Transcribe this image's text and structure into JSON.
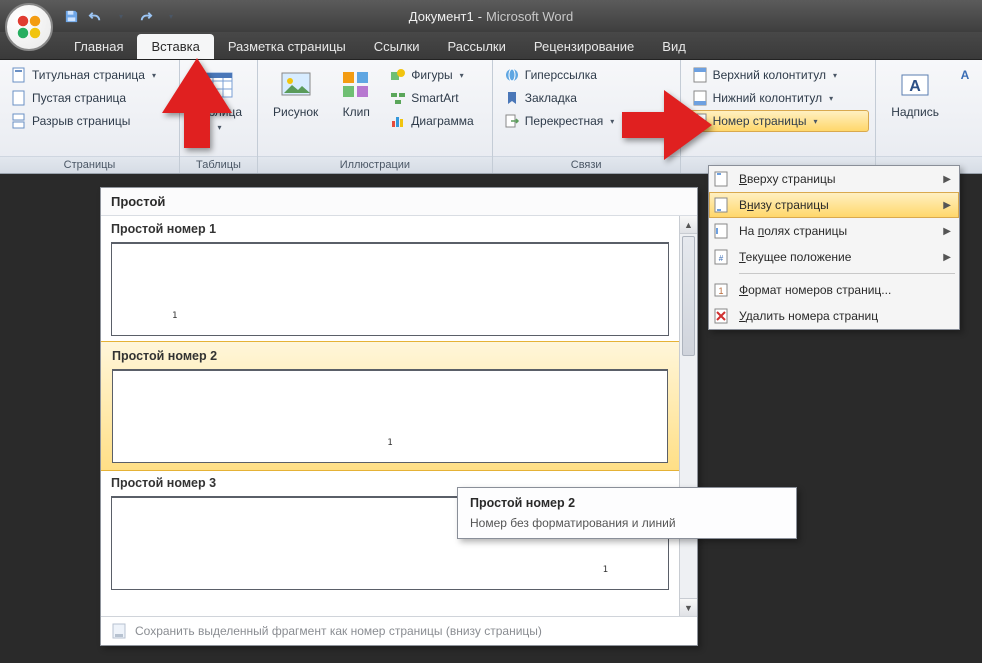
{
  "title": {
    "doc": "Документ1",
    "sep": "-",
    "app": "Microsoft Word"
  },
  "tabs": {
    "home": "Главная",
    "insert": "Вставка",
    "layout": "Разметка страницы",
    "refs": "Ссылки",
    "mail": "Рассылки",
    "review": "Рецензирование",
    "view": "Вид"
  },
  "ribbon": {
    "pages": {
      "title_page": "Титульная страница",
      "blank_page": "Пустая страница",
      "page_break": "Разрыв страницы",
      "group": "Страницы"
    },
    "tables": {
      "table": "Таблица",
      "group": "Таблицы"
    },
    "illus": {
      "picture": "Рисунок",
      "clip": "Клип",
      "shapes": "Фигуры",
      "smartart": "SmartArt",
      "chart": "Диаграмма",
      "group": "Иллюстрации"
    },
    "links": {
      "hyperlink": "Гиперссылка",
      "bookmark": "Закладка",
      "crossref": "Перекрестная",
      "group": "Связи"
    },
    "hf": {
      "header": "Верхний колонтитул",
      "footer": "Нижний колонтитул",
      "pagenum": "Номер страницы"
    },
    "text": {
      "textbox": "Надпись"
    }
  },
  "menu": {
    "top": "Вверху страницы",
    "bottom": "Внизу страницы",
    "margins": "На полях страницы",
    "current": "Текущее положение",
    "format": "Формат номеров страниц...",
    "remove": "Удалить номера страниц"
  },
  "gallery": {
    "header": "Простой",
    "items": [
      {
        "title": "Простой номер 1",
        "num": "1",
        "align": "left"
      },
      {
        "title": "Простой номер 2",
        "num": "1",
        "align": "center"
      },
      {
        "title": "Простой номер 3",
        "num": "1",
        "align": "right"
      }
    ],
    "footer": "Сохранить выделенный фрагмент как номер страницы (внизу страницы)"
  },
  "tooltip": {
    "title": "Простой номер 2",
    "body": "Номер без форматирования и линий"
  }
}
